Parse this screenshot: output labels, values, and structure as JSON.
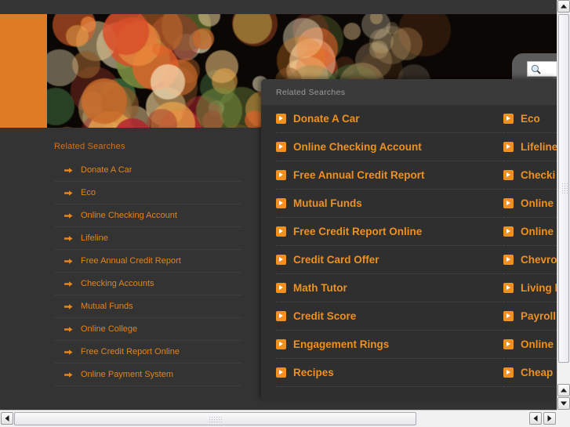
{
  "theme": {
    "accent_orange": "#E07B25",
    "link_orange": "#E2861F",
    "overlay_orange": "#F0901E",
    "page_background": "#333333",
    "overlay_background": "#2F2F2F",
    "overlay_header_background": "#3A3A3A"
  },
  "search": {
    "value": "",
    "placeholder": "",
    "icon": "magnifier-icon"
  },
  "background_panel": {
    "title": "Related Searches",
    "items": [
      {
        "label": "Donate A Car",
        "icon": "arrow-right-icon"
      },
      {
        "label": "Eco",
        "icon": "arrow-right-icon"
      },
      {
        "label": "Online Checking Account",
        "icon": "arrow-right-icon"
      },
      {
        "label": "Lifeline",
        "icon": "arrow-right-icon"
      },
      {
        "label": "Free Annual Credit Report",
        "icon": "arrow-right-icon"
      },
      {
        "label": "Checking Accounts",
        "icon": "arrow-right-icon"
      },
      {
        "label": "Mutual Funds",
        "icon": "arrow-right-icon"
      },
      {
        "label": "Online College",
        "icon": "arrow-right-icon"
      },
      {
        "label": "Free Credit Report Online",
        "icon": "arrow-right-icon"
      },
      {
        "label": "Online Payment System",
        "icon": "arrow-right-icon"
      }
    ]
  },
  "overlay_panel": {
    "title": "Related Searches",
    "left_column": [
      {
        "label": "Donate A Car",
        "icon": "chevron-right-square-icon"
      },
      {
        "label": "Online Checking Account",
        "icon": "chevron-right-square-icon"
      },
      {
        "label": "Free Annual Credit Report",
        "icon": "chevron-right-square-icon"
      },
      {
        "label": "Mutual Funds",
        "icon": "chevron-right-square-icon"
      },
      {
        "label": "Free Credit Report Online",
        "icon": "chevron-right-square-icon"
      },
      {
        "label": "Credit Card Offer",
        "icon": "chevron-right-square-icon"
      },
      {
        "label": "Math Tutor",
        "icon": "chevron-right-square-icon"
      },
      {
        "label": "Credit Score",
        "icon": "chevron-right-square-icon"
      },
      {
        "label": "Engagement Rings",
        "icon": "chevron-right-square-icon"
      },
      {
        "label": "Recipes",
        "icon": "chevron-right-square-icon"
      }
    ],
    "right_column": [
      {
        "label": "Eco",
        "icon": "chevron-right-square-icon"
      },
      {
        "label": "Lifeline",
        "icon": "chevron-right-square-icon"
      },
      {
        "label": "Checki",
        "icon": "chevron-right-square-icon"
      },
      {
        "label": "Online",
        "icon": "chevron-right-square-icon"
      },
      {
        "label": "Online",
        "icon": "chevron-right-square-icon"
      },
      {
        "label": "Chevro",
        "icon": "chevron-right-square-icon"
      },
      {
        "label": "Living l",
        "icon": "chevron-right-square-icon"
      },
      {
        "label": "Payroll",
        "icon": "chevron-right-square-icon"
      },
      {
        "label": "Online",
        "icon": "chevron-right-square-icon"
      },
      {
        "label": "Cheap",
        "icon": "chevron-right-square-icon"
      }
    ]
  },
  "scrollbars": {
    "vertical": {
      "up_arrow": "triangle-up-icon",
      "down_arrow": "triangle-down-icon",
      "thumb": "vertical-scroll-thumb"
    },
    "horizontal": {
      "left_arrow": "triangle-left-icon",
      "right_arrow": "triangle-right-icon",
      "thumb": "horizontal-scroll-thumb"
    }
  }
}
